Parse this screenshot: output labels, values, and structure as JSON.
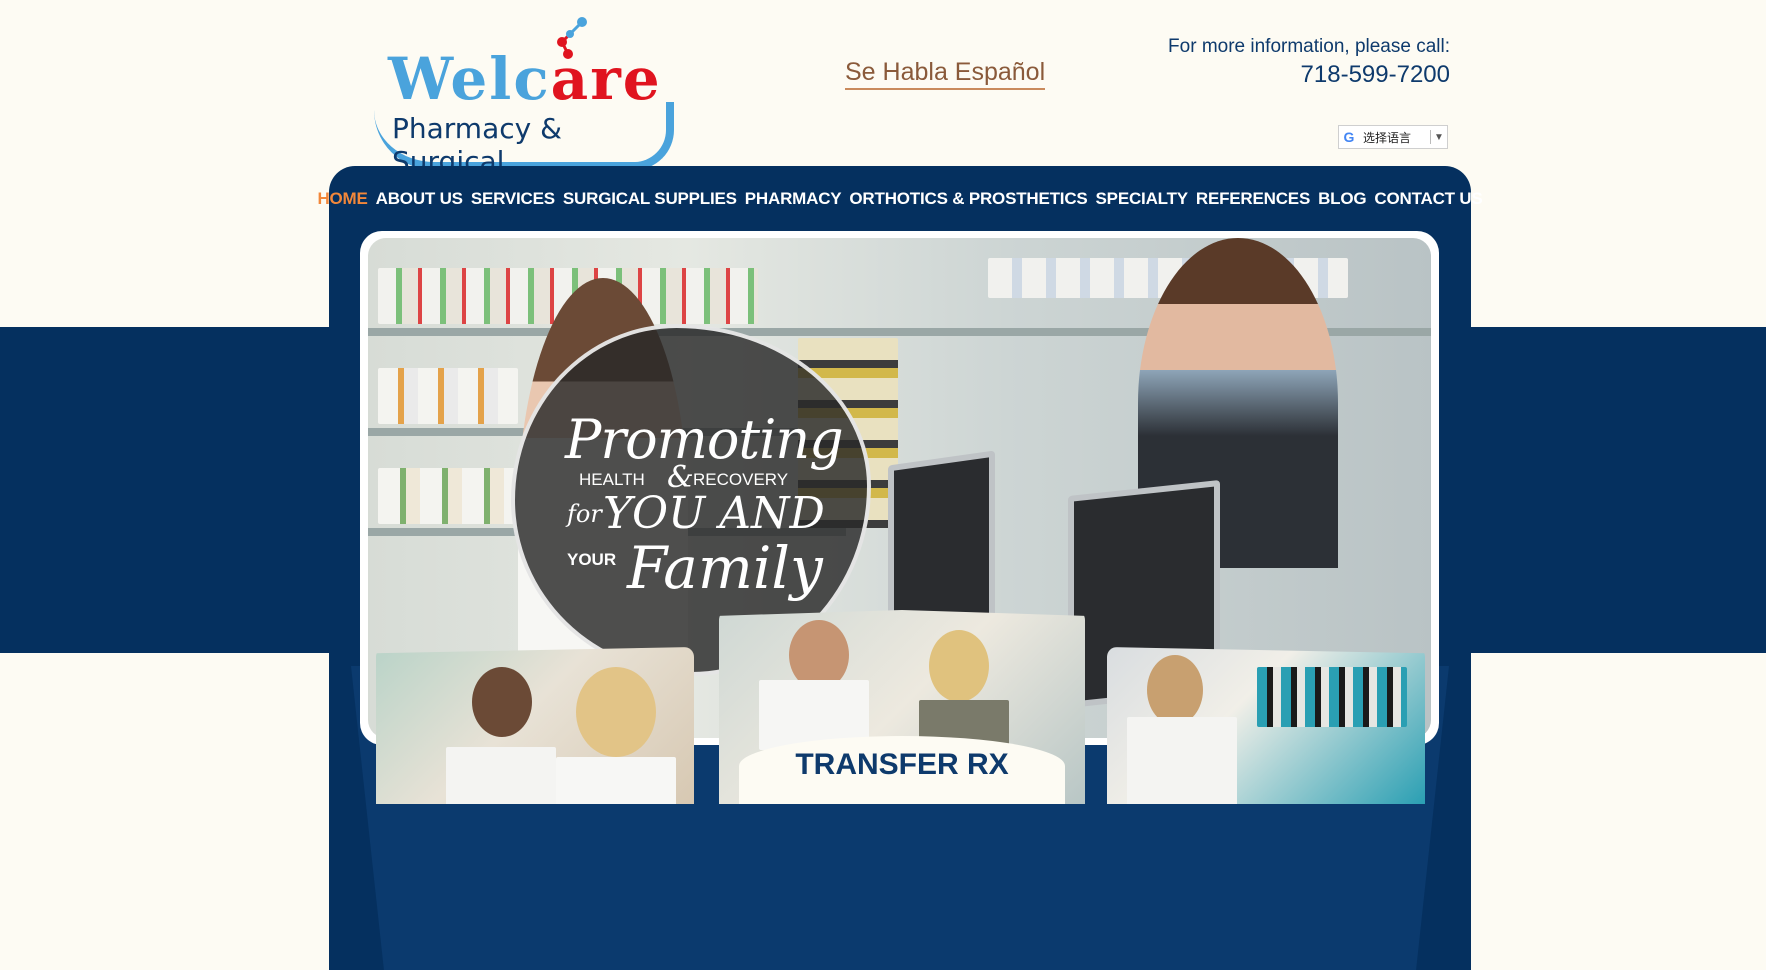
{
  "header": {
    "logo_word_part1": "Welc",
    "logo_word_part2": "are",
    "logo_sub": "Pharmacy & Surgical",
    "spanish_link": "Se Habla Español",
    "call_label": "For more information, please call:",
    "call_number": "718-599-7200",
    "translate_label": "选择语言",
    "translate_arrow": "▼"
  },
  "nav": {
    "items": [
      {
        "label": "HOME",
        "active": true
      },
      {
        "label": "ABOUT US"
      },
      {
        "label": "SERVICES"
      },
      {
        "label": "SURGICAL SUPPLIES"
      },
      {
        "label": "PHARMACY"
      },
      {
        "label": "ORTHOTICS & PROSTHETICS"
      },
      {
        "label": "SPECIALTY"
      },
      {
        "label": "REFERENCES"
      },
      {
        "label": "BLOG"
      },
      {
        "label": "CONTACT US"
      }
    ]
  },
  "hero": {
    "line1": "Promoting",
    "line2a": "HEALTH",
    "amp": "&",
    "line2b": "RECOVERY",
    "line3a": "for",
    "line3b": "YOU AND",
    "line4a": "YOUR",
    "line4b": "Family"
  },
  "cards": {
    "center_label": "TRANSFER RX"
  },
  "colors": {
    "navy": "#05305f",
    "accent_orange": "#f2873a",
    "logo_blue": "#4aa3dc",
    "logo_red": "#e0141f",
    "background": "#fdfbf3"
  }
}
